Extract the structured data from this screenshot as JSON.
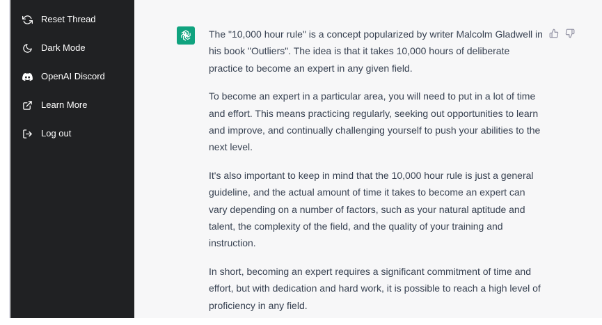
{
  "sidebar": {
    "items": [
      {
        "label": "Reset Thread",
        "icon": "reset-icon"
      },
      {
        "label": "Dark Mode",
        "icon": "moon-icon"
      },
      {
        "label": "OpenAI Discord",
        "icon": "discord-icon"
      },
      {
        "label": "Learn More",
        "icon": "external-link-icon"
      },
      {
        "label": "Log out",
        "icon": "log-out-icon"
      }
    ]
  },
  "conversation": {
    "assistant_icon": "openai-logo-icon",
    "paragraphs": [
      "The \"10,000 hour rule\" is a concept popularized by writer Malcolm Gladwell in his book \"Outliers\". The idea is that it takes 10,000 hours of deliberate practice to become an expert in any given field.",
      "To become an expert in a particular area, you will need to put in a lot of time and effort. This means practicing regularly, seeking out opportunities to learn and improve, and continually challenging yourself to push your abilities to the next level.",
      "It's also important to keep in mind that the 10,000 hour rule is just a general guideline, and the actual amount of time it takes to become an expert can vary depending on a number of factors, such as your natural aptitude and talent, the complexity of the field, and the quality of your training and instruction.",
      "In short, becoming an expert requires a significant commitment of time and effort, but with dedication and hard work, it is possible to reach a high level of proficiency in any field."
    ],
    "feedback": {
      "thumbs_up_icon": "thumbs-up-icon",
      "thumbs_down_icon": "thumbs-down-icon"
    }
  },
  "colors": {
    "sidebar_bg": "#202123",
    "main_bg": "#f7f7f8",
    "accent": "#10a37f",
    "text": "#374151"
  }
}
